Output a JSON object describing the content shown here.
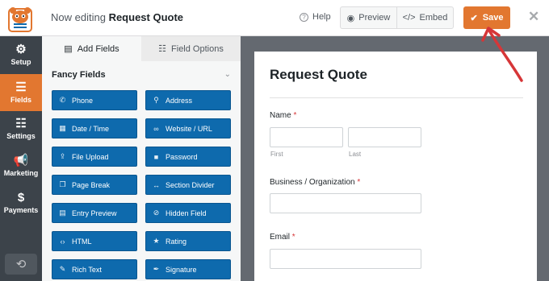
{
  "header": {
    "editing_prefix": "Now editing",
    "form_name": "Request Quote",
    "help_label": "Help",
    "preview_label": "Preview",
    "embed_label": "Embed",
    "save_label": "Save",
    "close_icon": "close-icon"
  },
  "sidebar": {
    "items": [
      {
        "label": "Setup",
        "icon": "gear-icon"
      },
      {
        "label": "Fields",
        "icon": "fields-list-icon",
        "active": true
      },
      {
        "label": "Settings",
        "icon": "sliders-icon"
      },
      {
        "label": "Marketing",
        "icon": "megaphone-icon"
      },
      {
        "label": "Payments",
        "icon": "dollar-icon"
      }
    ],
    "history_icon": "history-icon"
  },
  "panel": {
    "tabs": [
      {
        "label": "Add Fields",
        "icon": "list-icon",
        "active": true
      },
      {
        "label": "Field Options",
        "icon": "sliders-icon",
        "active": false
      }
    ],
    "section_title": "Fancy Fields",
    "fields": [
      {
        "label": "Phone",
        "icon": "phone-icon"
      },
      {
        "label": "Address",
        "icon": "map-marker-icon"
      },
      {
        "label": "Date / Time",
        "icon": "calendar-icon"
      },
      {
        "label": "Website / URL",
        "icon": "link-icon"
      },
      {
        "label": "File Upload",
        "icon": "upload-icon"
      },
      {
        "label": "Password",
        "icon": "lock-icon"
      },
      {
        "label": "Page Break",
        "icon": "copy-icon"
      },
      {
        "label": "Section Divider",
        "icon": "arrows-h-icon"
      },
      {
        "label": "Entry Preview",
        "icon": "file-text-icon"
      },
      {
        "label": "Hidden Field",
        "icon": "eye-slash-icon"
      },
      {
        "label": "HTML",
        "icon": "code-icon"
      },
      {
        "label": "Rating",
        "icon": "star-icon"
      },
      {
        "label": "Rich Text",
        "icon": "edit-icon"
      },
      {
        "label": "Signature",
        "icon": "pen-icon"
      }
    ]
  },
  "form": {
    "title": "Request Quote",
    "name_label": "Name",
    "first_sublabel": "First",
    "last_sublabel": "Last",
    "business_label": "Business / Organization",
    "email_label": "Email",
    "required_mark": "*"
  },
  "colors": {
    "accent": "#e27730",
    "field_button": "#0e6aad",
    "nav_bg": "#3c434a",
    "arrow": "#d63638"
  }
}
